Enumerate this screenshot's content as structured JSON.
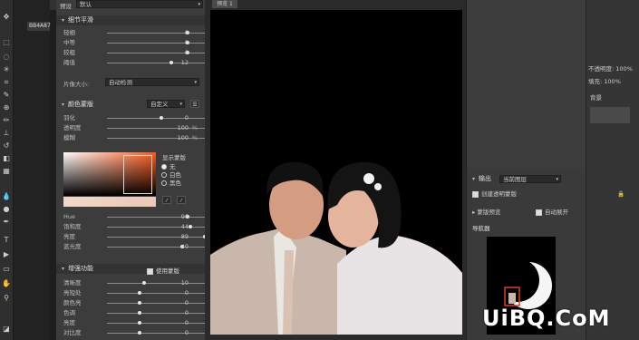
{
  "header": {
    "preset_label": "预设",
    "preset_value": "默认",
    "image_tab": "预览 1",
    "doc_tab": "BB4A87"
  },
  "sections": {
    "detail_smoothing": "细节平滑",
    "color_range": "颜色蒙版",
    "enhance": "增强功能"
  },
  "detail_rows": [
    {
      "label": "轻细",
      "value": "0"
    },
    {
      "label": "中等",
      "value": "0"
    },
    {
      "label": "较粗",
      "value": "0"
    },
    {
      "label": "阈值",
      "value": "12"
    }
  ],
  "image_size": {
    "label": "片像大小:",
    "value": "自动检测"
  },
  "mask": {
    "dropdown": "自定义",
    "rows": [
      {
        "label": "羽化",
        "value": "0",
        "unit": ""
      },
      {
        "label": "透明度",
        "value": "100",
        "unit": "%"
      },
      {
        "label": "模糊",
        "value": "100",
        "unit": "%"
      }
    ],
    "show_mask_label": "显示蒙版",
    "options": [
      "无",
      "白色",
      "黑色"
    ]
  },
  "hsl_rows": [
    {
      "label": "Hue",
      "value": "96"
    },
    {
      "label": "饱和度",
      "value": "44"
    },
    {
      "label": "亮度",
      "value": "89"
    },
    {
      "label": "蓝光度",
      "value": "40"
    }
  ],
  "enhance": {
    "use_mask_label": "使用蒙版",
    "rows": [
      {
        "label": "清晰度",
        "value": "10"
      },
      {
        "label": "亮短处",
        "value": "0"
      },
      {
        "label": "颜色亮",
        "value": "0"
      },
      {
        "label": "色调",
        "value": "0"
      },
      {
        "label": "亮度",
        "value": "0"
      },
      {
        "label": "对比度",
        "value": "0"
      }
    ]
  },
  "right": {
    "output_label": "输出",
    "output_value": "当前图层",
    "create_mask": "创建透明蒙版",
    "mask_preview": "蒙版预览",
    "auto_expand": "自动展开",
    "navigator": "导航器",
    "opacity_label": "不透明度:",
    "opacity_value": "100%",
    "fill_label": "填充:",
    "fill_value": "100%",
    "layer_label": "背景"
  },
  "watermark": "UiBQ.CoM"
}
